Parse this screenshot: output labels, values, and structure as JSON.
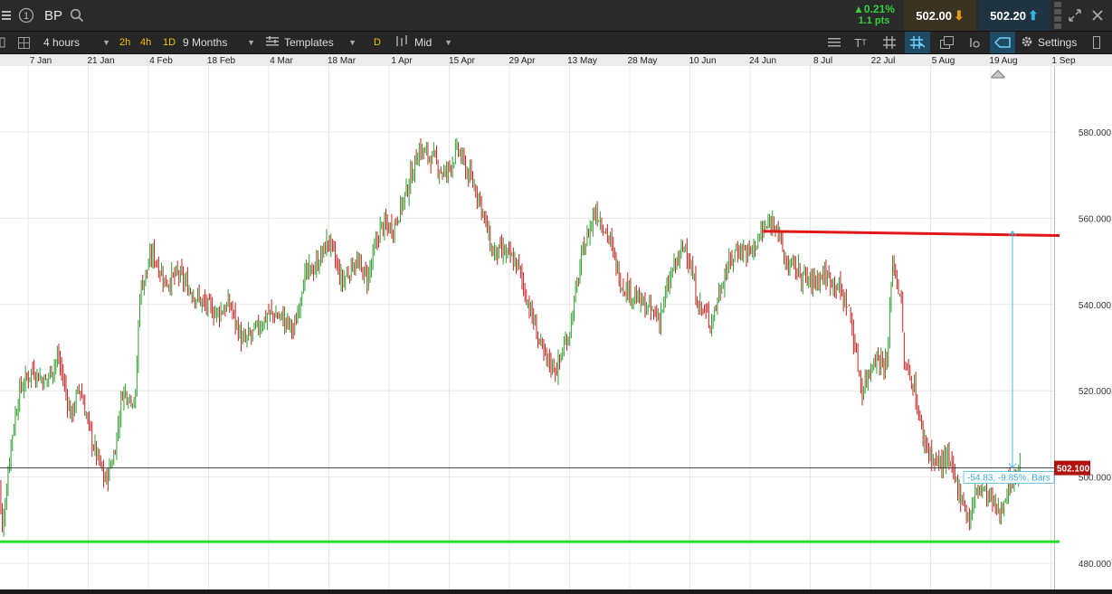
{
  "header": {
    "symbol": "BP",
    "info_icon": "info-icon",
    "change_pct": "0.21%",
    "change_pts": "1.1 pts",
    "sell_price": "502.00",
    "buy_price": "502.20"
  },
  "toolbar": {
    "interval": "4 hours",
    "quick_2h": "2h",
    "quick_4h": "4h",
    "quick_1d": "1D",
    "range": "9 Months",
    "templates": "Templates",
    "d_badge": "D",
    "price_type": "Mid",
    "settings": "Settings"
  },
  "colors": {
    "up": "#2e9e2e",
    "down": "#c22323",
    "resistance": "#e01818",
    "support": "#22e02a",
    "measure": "#4ab8e0",
    "current_price_bg": "#b31010"
  },
  "chart_data": {
    "type": "candlestick",
    "title": "",
    "x_ticks": [
      "7 Jan",
      "21 Jan",
      "4 Feb",
      "18 Feb",
      "4 Mar",
      "18 Mar",
      "1 Apr",
      "15 Apr",
      "29 Apr",
      "13 May",
      "28 May",
      "10 Jun",
      "24 Jun",
      "8 Jul",
      "22 Jul",
      "5 Aug",
      "19 Aug",
      "1 Sep"
    ],
    "y_ticks": [
      "480.000",
      "500.000",
      "520.000",
      "540.000",
      "560.000",
      "580.000"
    ],
    "ylim": [
      476,
      590
    ],
    "current_price_label": "502.100",
    "current_price": 502.1,
    "measure_label": "-54.83, -9.85%, Bars",
    "resistance_line": {
      "from_date": "2019-06-27",
      "to_date": "2019-09-04",
      "start": 557.0,
      "end": 556.0
    },
    "support_line": {
      "from_date": "2018-12-31",
      "to_date": "2019-09-04",
      "value": 485.0
    },
    "measure_span": {
      "from": 557.0,
      "to": 502.1
    },
    "anchors": [
      [
        "2018-12-31",
        505
      ],
      [
        "2019-01-01",
        487
      ],
      [
        "2019-01-03",
        508
      ],
      [
        "2019-01-05",
        520
      ],
      [
        "2019-01-08",
        525
      ],
      [
        "2019-01-11",
        522
      ],
      [
        "2019-01-14",
        528
      ],
      [
        "2019-01-17",
        514
      ],
      [
        "2019-01-19",
        521
      ],
      [
        "2019-01-22",
        508
      ],
      [
        "2019-01-25",
        499
      ],
      [
        "2019-01-27",
        505
      ],
      [
        "2019-01-29",
        520
      ],
      [
        "2019-02-01",
        518
      ],
      [
        "2019-02-02",
        543
      ],
      [
        "2019-02-05",
        552
      ],
      [
        "2019-02-08",
        545
      ],
      [
        "2019-02-11",
        547
      ],
      [
        "2019-02-14",
        543
      ],
      [
        "2019-02-17",
        540
      ],
      [
        "2019-02-20",
        538
      ],
      [
        "2019-02-23",
        540
      ],
      [
        "2019-02-26",
        531
      ],
      [
        "2019-03-01",
        534
      ],
      [
        "2019-03-04",
        538
      ],
      [
        "2019-03-07",
        537
      ],
      [
        "2019-03-10",
        534
      ],
      [
        "2019-03-12",
        546
      ],
      [
        "2019-03-15",
        549
      ],
      [
        "2019-03-18",
        555
      ],
      [
        "2019-03-21",
        545
      ],
      [
        "2019-03-24",
        550
      ],
      [
        "2019-03-27",
        546
      ],
      [
        "2019-03-30",
        558
      ],
      [
        "2019-04-02",
        558
      ],
      [
        "2019-04-05",
        566
      ],
      [
        "2019-04-08",
        576
      ],
      [
        "2019-04-11",
        574
      ],
      [
        "2019-04-14",
        570
      ],
      [
        "2019-04-17",
        576
      ],
      [
        "2019-04-19",
        571
      ],
      [
        "2019-04-22",
        565
      ],
      [
        "2019-04-25",
        552
      ],
      [
        "2019-04-28",
        552
      ],
      [
        "2019-05-01",
        549
      ],
      [
        "2019-05-04",
        538
      ],
      [
        "2019-05-07",
        528
      ],
      [
        "2019-05-10",
        525
      ],
      [
        "2019-05-13",
        534
      ],
      [
        "2019-05-16",
        552
      ],
      [
        "2019-05-19",
        562
      ],
      [
        "2019-05-22",
        556
      ],
      [
        "2019-05-25",
        545
      ],
      [
        "2019-05-28",
        542
      ],
      [
        "2019-05-31",
        539
      ],
      [
        "2019-06-03",
        537
      ],
      [
        "2019-06-06",
        548
      ],
      [
        "2019-06-09",
        554
      ],
      [
        "2019-06-12",
        540
      ],
      [
        "2019-06-15",
        536
      ],
      [
        "2019-06-18",
        547
      ],
      [
        "2019-06-21",
        553
      ],
      [
        "2019-06-24",
        552
      ],
      [
        "2019-06-27",
        557
      ],
      [
        "2019-06-30",
        560
      ],
      [
        "2019-07-02",
        550
      ],
      [
        "2019-07-05",
        548
      ],
      [
        "2019-07-08",
        545
      ],
      [
        "2019-07-11",
        547
      ],
      [
        "2019-07-14",
        545
      ],
      [
        "2019-07-17",
        539
      ],
      [
        "2019-07-20",
        520
      ],
      [
        "2019-07-23",
        528
      ],
      [
        "2019-07-26",
        526
      ],
      [
        "2019-07-27",
        551
      ],
      [
        "2019-07-29",
        542
      ],
      [
        "2019-07-30",
        525
      ],
      [
        "2019-08-01",
        522
      ],
      [
        "2019-08-03",
        510
      ],
      [
        "2019-08-06",
        503
      ],
      [
        "2019-08-09",
        504
      ],
      [
        "2019-08-12",
        496
      ],
      [
        "2019-08-14",
        490
      ],
      [
        "2019-08-16",
        498
      ],
      [
        "2019-08-19",
        495
      ],
      [
        "2019-08-21",
        491
      ],
      [
        "2019-08-23",
        498
      ],
      [
        "2019-08-26",
        502
      ]
    ]
  }
}
